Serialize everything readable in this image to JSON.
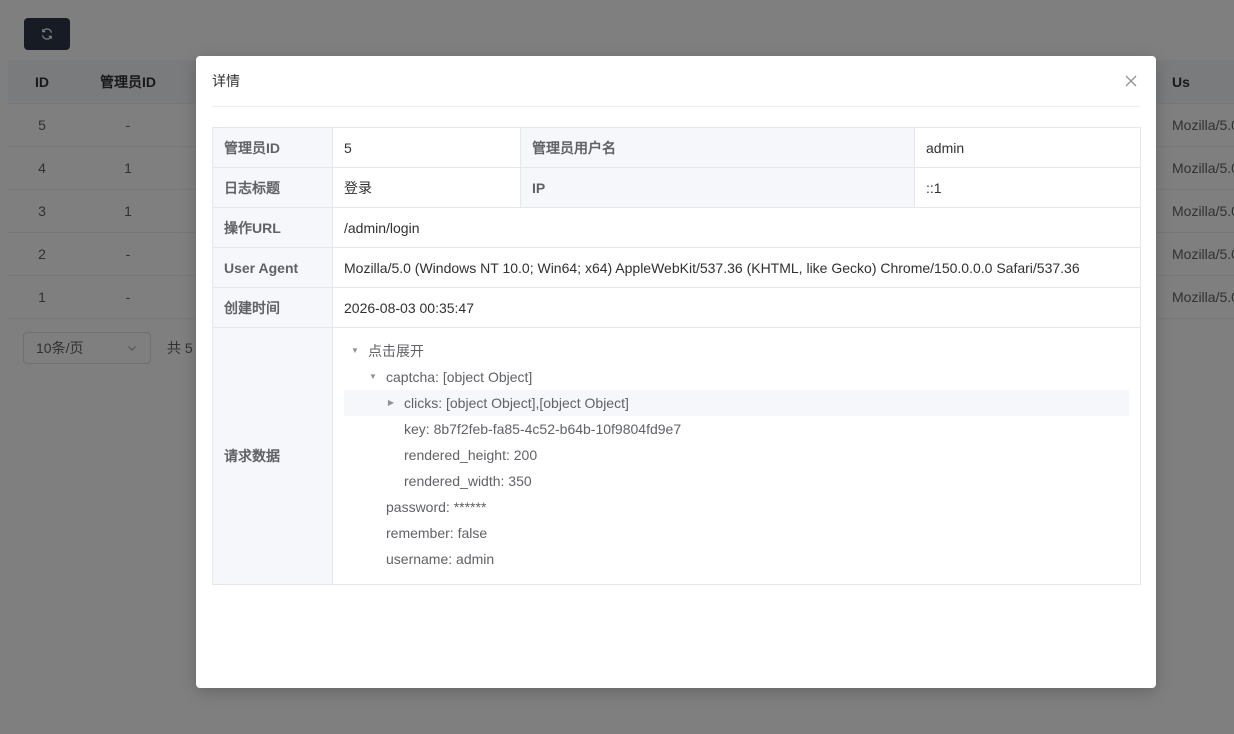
{
  "background": {
    "refresh_icon": "refresh-icon",
    "table_headers": {
      "id": "ID",
      "admin_id": "管理员ID",
      "user_agent": "Us"
    },
    "rows": [
      {
        "id": "5",
        "admin_id": "-",
        "user_agent": "Mozilla/5.0"
      },
      {
        "id": "4",
        "admin_id": "1",
        "user_agent": "Mozilla/5.0"
      },
      {
        "id": "3",
        "admin_id": "1",
        "user_agent": "Mozilla/5.0"
      },
      {
        "id": "2",
        "admin_id": "-",
        "user_agent": "Mozilla/5.0"
      },
      {
        "id": "1",
        "admin_id": "-",
        "user_agent": "Mozilla/5.0"
      }
    ],
    "pager": {
      "page_size": "10条/页",
      "total": "共 5"
    }
  },
  "dialog": {
    "title": "详情",
    "close_icon": "close-icon",
    "fields": {
      "admin_id_label": "管理员ID",
      "admin_id": "5",
      "admin_username_label": "管理员用户名",
      "admin_username": "admin",
      "title_label": "日志标题",
      "title": "登录",
      "ip_label": "IP",
      "ip": "::1",
      "url_label": "操作URL",
      "url": "/admin/login",
      "ua_label": "User Agent",
      "ua": "Mozilla/5.0 (Windows NT 10.0; Win64; x64) AppleWebKit/537.36 (KHTML, like Gecko) Chrome/150.0.0.0 Safari/537.36",
      "created_label": "创建时间",
      "created": "2026-08-03 00:35:47",
      "request_label": "请求数据"
    },
    "tree": {
      "root": "点击展开",
      "captcha": "captcha: [object Object]",
      "clicks": "clicks: [object Object],[object Object]",
      "key": "key: 8b7f2feb-fa85-4c52-b64b-10f9804fd9e7",
      "rendered_height": "rendered_height: 200",
      "rendered_width": "rendered_width: 350",
      "password": "password: ******",
      "remember": "remember: false",
      "username": "username: admin"
    }
  }
}
